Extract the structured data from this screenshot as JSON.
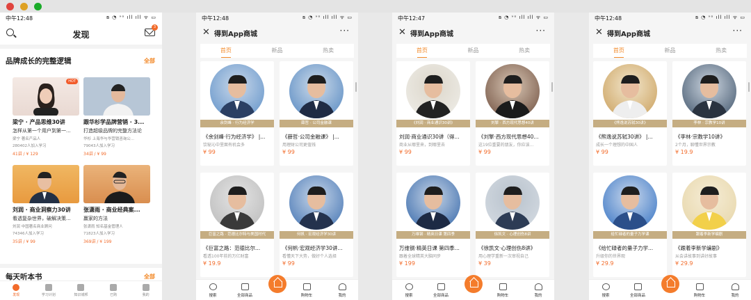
{
  "window": {
    "dots": [
      "#e0443e",
      "#dea123",
      "#1aab29"
    ]
  },
  "status": {
    "p1": "中午12:48",
    "p2": "中午12:48",
    "p3": "中午12:47",
    "p4": "中午12:48",
    "icons": "ʙ ◔ ᵛᵒ ıll ıll ᯤ ▭"
  },
  "discover": {
    "title": "发现",
    "mail_badge": "3",
    "section1": {
      "title": "品牌成长的完整逻辑",
      "more": "全部"
    },
    "hot": "HOT",
    "cards": [
      {
        "title": "梁宁 · 产品思维30讲",
        "sub": "怎样从第一个用户到第一...",
        "meta": "梁宁  著名产品人",
        "count": "280402人加入学习",
        "price": "41讲 / ¥ 129"
      },
      {
        "title": "跟华杉学品牌营销 · 3...",
        "sub": "打造超级品牌的完整方法论",
        "meta": "华杉  上海华与华营销咨询公...",
        "count": "79043人加入学习",
        "price": "34讲 / ¥ 99"
      },
      {
        "title": "刘润 · 商业洞察力30讲",
        "sub": "看透复杂世界，破解决策...",
        "meta": "刘润  中国著名商业顾问",
        "count": "74346人加入学习",
        "price": "35讲 / ¥ 99"
      },
      {
        "title": "张潇雨 · 商业经典案...",
        "sub": "赢家的方法",
        "meta": "张潇雨  知名基金管理人",
        "count": "71823人加入学习",
        "price": "369讲 / ¥ 199"
      }
    ],
    "section2": {
      "title": "每天听本书",
      "more": "全部"
    },
    "tabs": [
      "发现",
      "学习计划",
      "知识城邦",
      "已购",
      "我的"
    ]
  },
  "store": {
    "title": "得到App商城",
    "tabs": [
      "首页",
      "新品",
      "热卖"
    ],
    "bottom": [
      "搜索",
      "全部商品",
      "购物车",
      "我的"
    ],
    "phones": [
      [
        {
          "band": "余剑峰 · 行为经济学",
          "title": "《余剑峰·行为经济学》 |...",
          "sub": "饮秘沁中里面有机会多",
          "price": "¥ 99"
        },
        {
          "band": "薛哲 · 公司金融课",
          "title": "《薛哲·公司金融课》 |...",
          "sub": "用理财公司更值钱",
          "price": "¥ 99"
        },
        {
          "band": "巨富之路 · 范德比尔特与美国时代",
          "title": "《巨富之路：范德比尔...",
          "sub": "看透100年前的万亿财富",
          "price": "¥ 19.9"
        },
        {
          "band": "何帆 · 宏观经济学30讲",
          "title": "《何帆·宏观经济学30讲...",
          "sub": "看懂天下大势，做好个人选择",
          "price": "¥ 99"
        }
      ],
      [
        {
          "band": "《刘润 · 商业通识30讲》",
          "title": "刘润·商业通识30讲（得...",
          "sub": "商业从哪里来，到哪里去",
          "price": "¥ 99"
        },
        {
          "band": "刘擎 · 西方现代思想40讲",
          "title": "《刘擎·西方现代思想40...",
          "sub": "这19位重要的朋友，你应该...",
          "price": "¥ 99"
        },
        {
          "band": "万维钢 · 精英日课 第四季",
          "title": "万维钢·精英日课 第四季...",
          "sub": "跟着全球精英大脑同步",
          "price": "¥ 199"
        },
        {
          "band": "徐凯文 · 心理创伤8讲",
          "title": "《徐凯文·心理创伤8讲》",
          "sub": "用心理学重新一次审视自己",
          "price": "¥ 39"
        }
      ],
      [
        {
          "band": "《熊逸说苏轼30讲》",
          "title": "《熊逸说苏轼30讲》 |...",
          "sub": "成长一个理想的中国人",
          "price": "¥ 99"
        },
        {
          "band": "李林 · 宗教学10讲",
          "title": "《李林·宗教学10讲》",
          "sub": "2个月，聊懂世界宗教",
          "price": "¥ 19.9"
        },
        {
          "band": "给忙碌者的量子力学课",
          "title": "《给忙碌者的量子力学...",
          "sub": "升级你的世界观",
          "price": "¥ 29.9"
        },
        {
          "band": "跟着李新学编剧",
          "title": "《跟着李新学编剧》",
          "sub": "从会讲故事到讲好故事",
          "price": "¥ 29.9"
        }
      ]
    ]
  }
}
